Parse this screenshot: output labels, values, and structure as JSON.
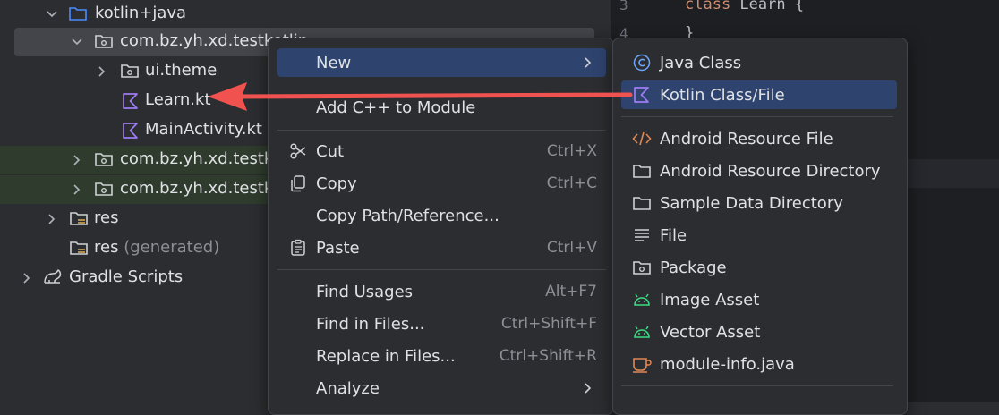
{
  "tree": {
    "items": [
      {
        "label": "kotlin+java"
      },
      {
        "label": "com.bz.yh.xd.testkotlin"
      },
      {
        "label": "ui.theme"
      },
      {
        "label": "Learn.kt"
      },
      {
        "label": "MainActivity.kt"
      },
      {
        "label": "com.bz.yh.xd.testkotlin"
      },
      {
        "label": "com.bz.yh.xd.testkotlin"
      },
      {
        "label": "res"
      },
      {
        "label": "res",
        "suffix": "(generated)"
      },
      {
        "label": "Gradle Scripts"
      }
    ]
  },
  "editor": {
    "lines": [
      {
        "num": "3",
        "keyword": "class",
        "rest": " Learn {"
      },
      {
        "num": "4",
        "keyword": "",
        "rest": "}"
      }
    ]
  },
  "context_menu": {
    "items": [
      {
        "label": "New",
        "shortcut": ""
      },
      {
        "label": "Add C++ to Module",
        "shortcut": ""
      },
      {
        "label": "Cut",
        "shortcut": "Ctrl+X"
      },
      {
        "label": "Copy",
        "shortcut": "Ctrl+C"
      },
      {
        "label": "Copy Path/Reference...",
        "shortcut": ""
      },
      {
        "label": "Paste",
        "shortcut": "Ctrl+V"
      },
      {
        "label": "Find Usages",
        "shortcut": "Alt+F7"
      },
      {
        "label": "Find in Files...",
        "shortcut": "Ctrl+Shift+F"
      },
      {
        "label": "Replace in Files...",
        "shortcut": "Ctrl+Shift+R"
      },
      {
        "label": "Analyze",
        "shortcut": ""
      }
    ]
  },
  "submenu": {
    "items": [
      {
        "label": "Java Class"
      },
      {
        "label": "Kotlin Class/File"
      },
      {
        "label": "Android Resource File"
      },
      {
        "label": "Android Resource Directory"
      },
      {
        "label": "Sample Data Directory"
      },
      {
        "label": "File"
      },
      {
        "label": "Package"
      },
      {
        "label": "Image Asset"
      },
      {
        "label": "Vector Asset"
      },
      {
        "label": "module-info.java"
      }
    ]
  },
  "colors": {
    "highlight": "#2e436e",
    "annotation_arrow": "#f0524f",
    "kotlin_icon": "#9d7cf2",
    "android_icon": "#3ddc84"
  }
}
